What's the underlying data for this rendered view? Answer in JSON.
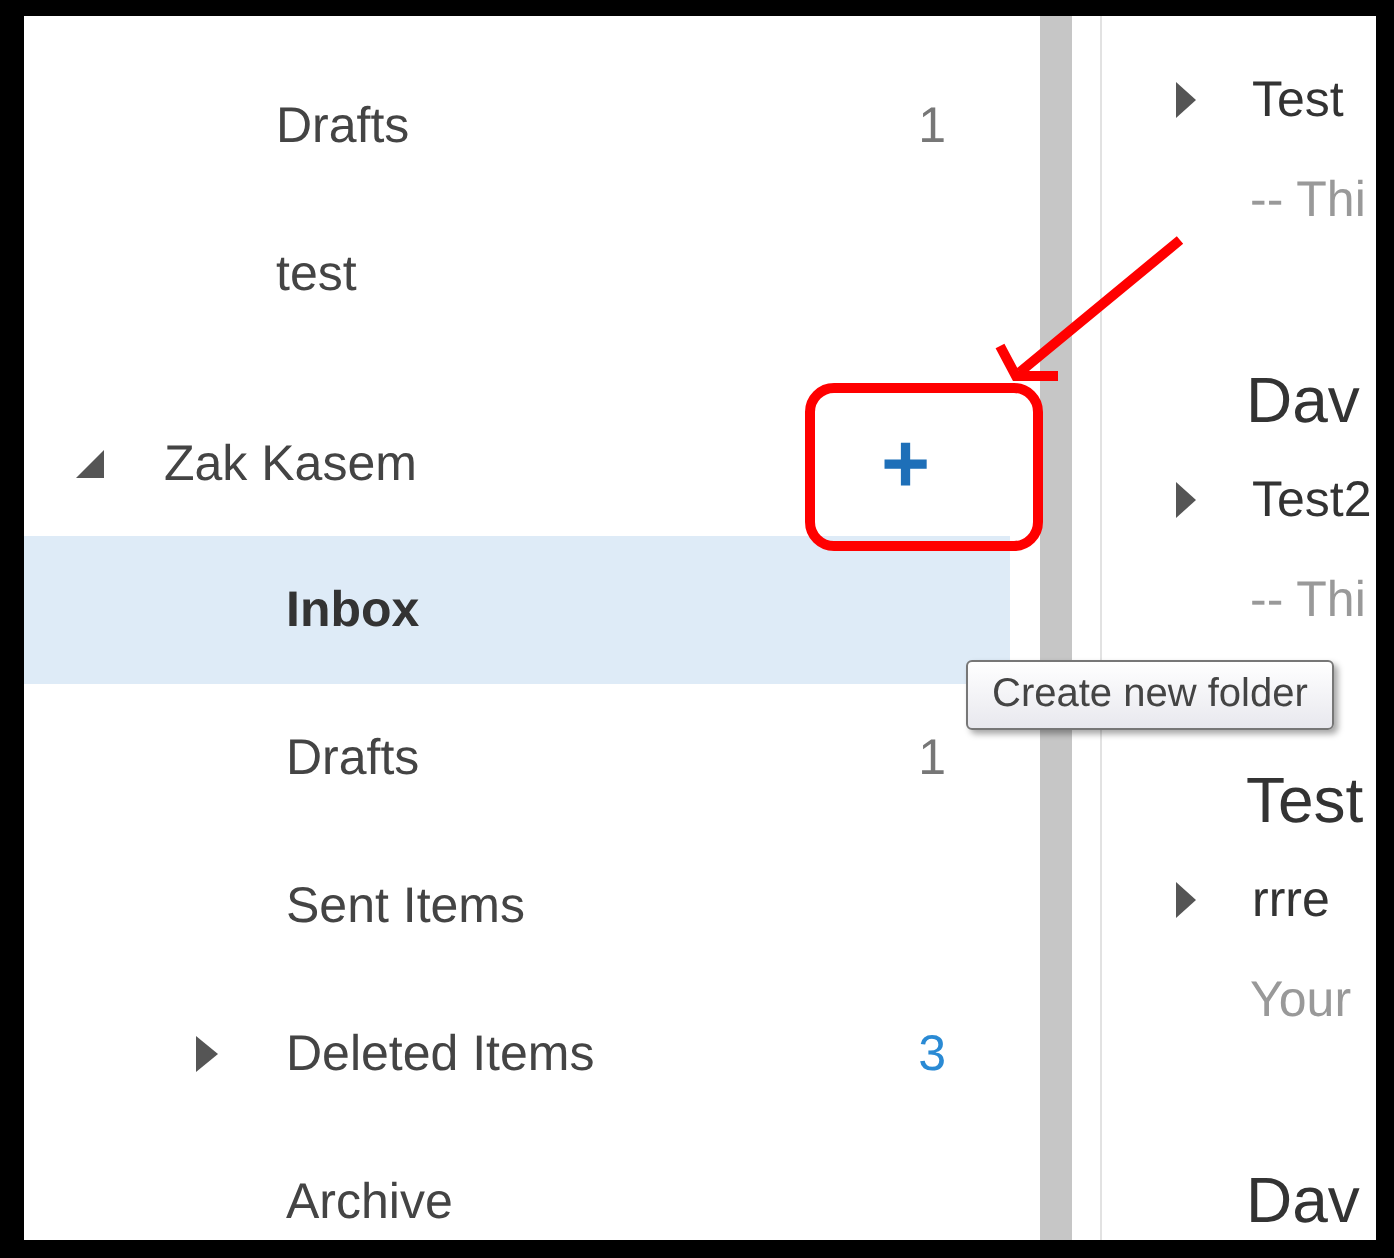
{
  "folder_pane": {
    "top_folders": [
      {
        "name": "Drafts",
        "count": "1"
      },
      {
        "name": "test"
      }
    ],
    "account": {
      "name": "Zak Kasem",
      "expanded": true,
      "add_button": "+",
      "folders": [
        {
          "name": "Inbox",
          "selected": true,
          "expandable": false
        },
        {
          "name": "Drafts",
          "count": "1",
          "selected": false,
          "expandable": false,
          "unread": false
        },
        {
          "name": "Sent Items",
          "selected": false,
          "expandable": false
        },
        {
          "name": "Deleted Items",
          "count": "3",
          "selected": false,
          "expandable": true,
          "unread": true
        },
        {
          "name": "Archive",
          "selected": false,
          "expandable": false
        }
      ]
    }
  },
  "tooltip": "Create new folder",
  "message_list": {
    "items": [
      {
        "kind": "message",
        "subject": "Test",
        "preview": "-- Thi"
      },
      {
        "kind": "heading",
        "text": "Dav"
      },
      {
        "kind": "message",
        "subject": "Test2",
        "preview": "-- Thi"
      },
      {
        "kind": "heading",
        "text": "Test"
      },
      {
        "kind": "message",
        "subject": "rrre",
        "preview": "Your"
      },
      {
        "kind": "heading",
        "text": "Dav"
      }
    ]
  }
}
